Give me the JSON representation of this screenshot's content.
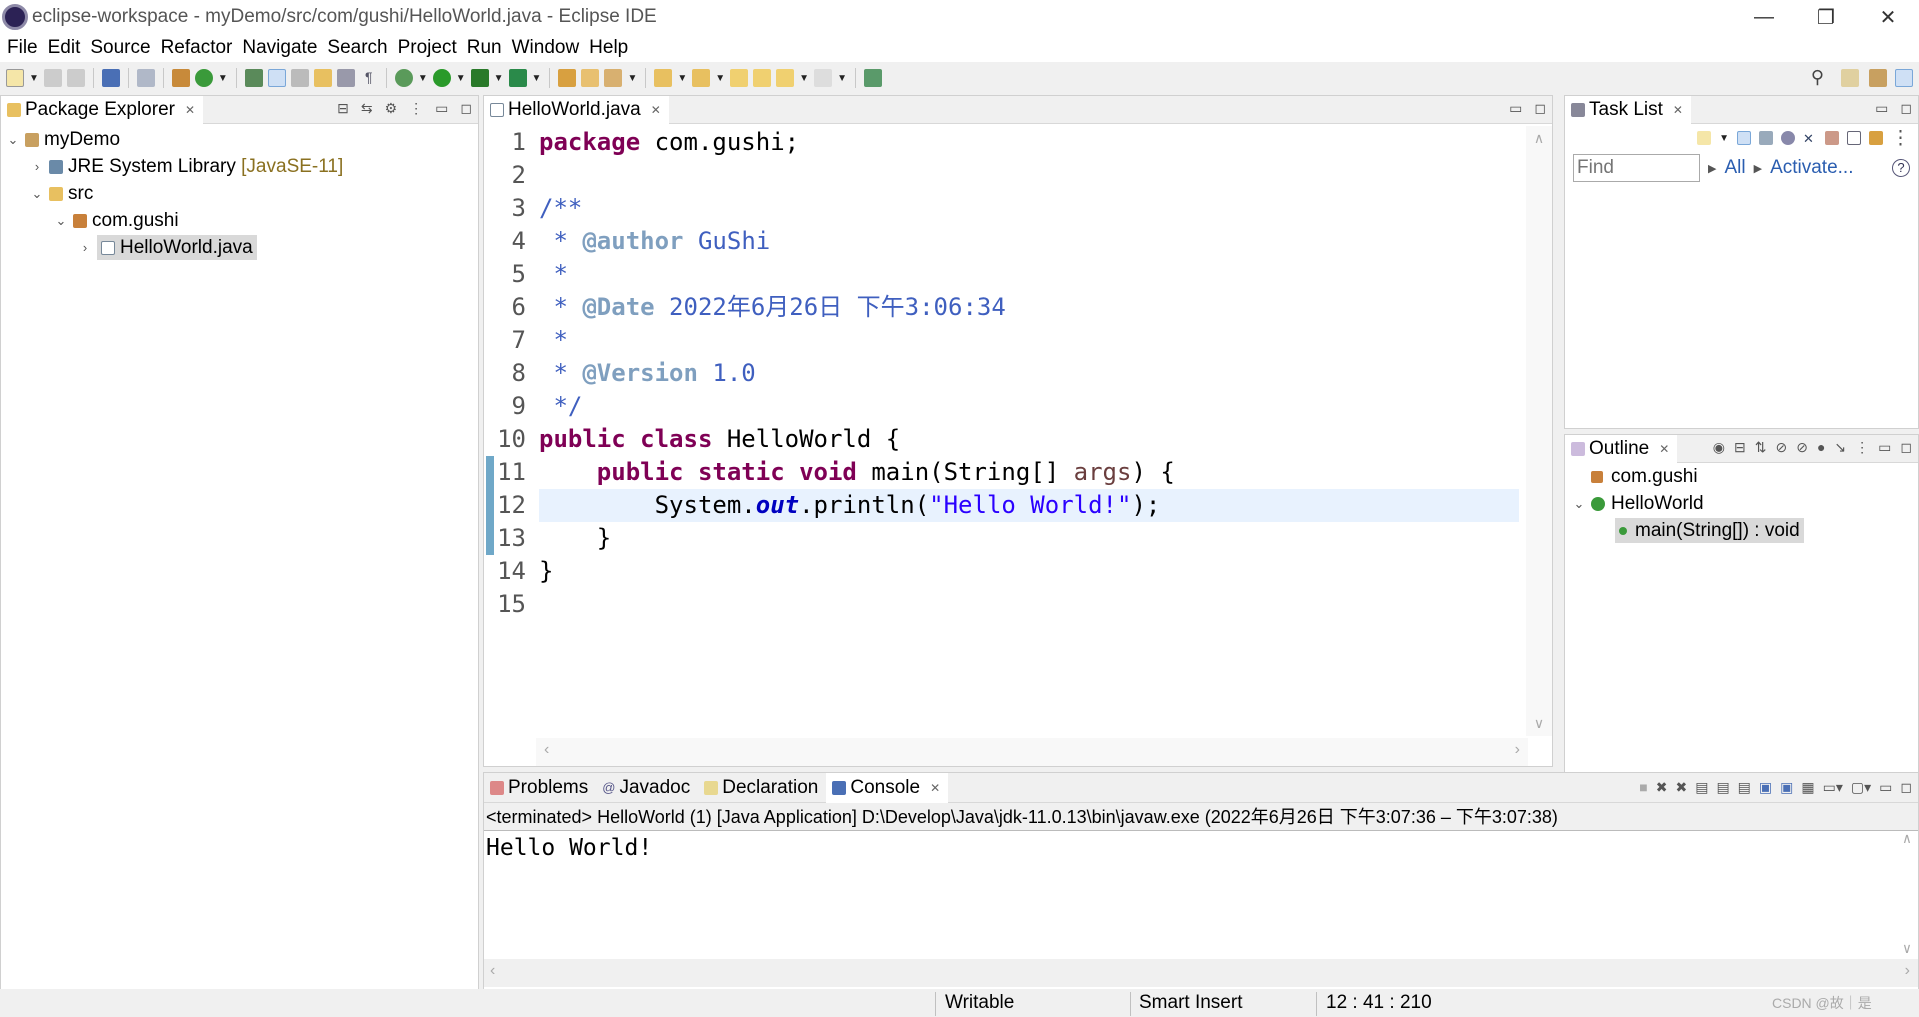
{
  "window": {
    "title": "eclipse-workspace - myDemo/src/com/gushi/HelloWorld.java - Eclipse IDE",
    "minimize": "—",
    "restore": "❐",
    "close": "✕"
  },
  "menu": [
    "File",
    "Edit",
    "Source",
    "Refactor",
    "Navigate",
    "Search",
    "Project",
    "Run",
    "Window",
    "Help"
  ],
  "package_explorer": {
    "title": "Package Explorer",
    "tree": [
      {
        "label": "myDemo",
        "extra": ""
      },
      {
        "label": "JRE System Library",
        "extra": "[JavaSE-11]"
      },
      {
        "label": "src",
        "extra": ""
      },
      {
        "label": "com.gushi",
        "extra": ""
      },
      {
        "label": "HelloWorld.java",
        "extra": ""
      }
    ]
  },
  "editor": {
    "tab": "HelloWorld.java",
    "line_numbers": [
      "1",
      "2",
      "3",
      "4",
      "5",
      "6",
      "7",
      "8",
      "9",
      "10",
      "11",
      "12",
      "13",
      "14",
      "15"
    ],
    "code": {
      "l1a": "package",
      "l1b": " com.gushi;",
      "l3": "/**",
      "l4a": " * ",
      "l4b": "@author",
      "l4c": " GuShi",
      "l5": " *",
      "l6a": " * ",
      "l6b": "@Date",
      "l6c": " 2022年6月26日 下午3:06:34",
      "l7": " *",
      "l8a": " * ",
      "l8b": "@Version",
      "l8c": " 1.0",
      "l9": " */",
      "l10a": "public class",
      "l10b": " HelloWorld {",
      "l11a": "    public static void",
      "l11b": " main(String[] ",
      "l11c": "args",
      "l11d": ") {",
      "l12a": "        System.",
      "l12b": "out",
      "l12c": ".println(",
      "l12d": "\"Hello World!\"",
      "l12e": ");",
      "l13": "    }",
      "l14": "}"
    },
    "current_line": "12"
  },
  "task_list": {
    "title": "Task List",
    "find_placeholder": "Find",
    "all": "All",
    "activate": "Activate...",
    "help": "?"
  },
  "outline": {
    "title": "Outline",
    "items": [
      "com.gushi",
      "HelloWorld",
      "main(String[]) : void"
    ]
  },
  "bottom": {
    "tabs": [
      "Problems",
      "Javadoc",
      "Declaration",
      "Console"
    ],
    "console_header": "<terminated> HelloWorld (1) [Java Application] D:\\Develop\\Java\\jdk-11.0.13\\bin\\javaw.exe  (2022年6月26日 下午3:07:36 – 下午3:07:38)",
    "output": "Hello World!"
  },
  "status": {
    "writable": "Writable",
    "insert": "Smart Insert",
    "position": "12 : 41 : 210",
    "watermark": "CSDN @故｜是"
  },
  "colors": {
    "keyword": "#7f0055",
    "javadoc": "#3f5fbf",
    "string": "#2a00ff",
    "current_line": "#e8f2fe",
    "selection": "#d9d9d9"
  }
}
